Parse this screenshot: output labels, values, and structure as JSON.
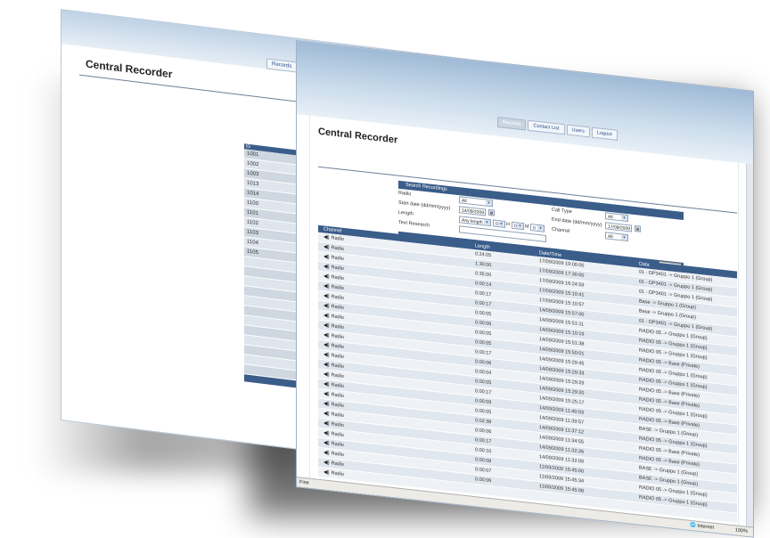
{
  "nav_tabs": [
    "Records",
    "Contact List",
    "Users",
    "Logout"
  ],
  "app_title": "Central Recorder",
  "back_table": {
    "rows": [
      "1001",
      "1002",
      "1003",
      "1013",
      "1014",
      "1100",
      "1101",
      "1102",
      "1103",
      "1104",
      "1105"
    ]
  },
  "search": {
    "heading": "Search Recordings",
    "radio_label": "Radio",
    "radio_value": "All",
    "start_date_label": "Start date (dd/mm/yyyy)",
    "start_date_value": "14/09/2009",
    "length_label": "Length",
    "length_value": "Any length",
    "length_h": "0",
    "length_m": "0",
    "length_s": "0",
    "h_unit": "H",
    "m_unit": "M",
    "text_research_label": "Text Research",
    "text_research_value": "",
    "call_type_label": "Call Type",
    "call_type_value": "All",
    "end_date_label": "End date (dd/mm/yyyy)",
    "end_date_value": "17/09/2009",
    "channel_label": "Channel",
    "channel_value": "All",
    "search_button": "Search"
  },
  "records": {
    "headers": [
      "Channel",
      "Length",
      "Date/Time",
      "Data"
    ],
    "rows": [
      [
        "Radio",
        "0:24:05",
        "17/09/2009 19:00:00",
        "01 - DP3401 -> Gruppo 1 (Group)"
      ],
      [
        "Radio",
        "1:30:00",
        "17/09/2009 17:30:00",
        "01 - DP3401 -> Gruppo 1 (Group)"
      ],
      [
        "Radio",
        "0:35:00",
        "17/09/2009 16:24:59",
        "01 - DP3401 -> Gruppo 1 (Group)"
      ],
      [
        "Radio",
        "0:00:14",
        "17/09/2009 15:10:41",
        "Base -> Gruppo 1 (Group)"
      ],
      [
        "Radio",
        "0:00:17",
        "17/09/2009 15:10:57",
        "Base -> Gruppo 1 (Group)"
      ],
      [
        "Radio",
        "0:00:17",
        "14/09/2009 15:57:00",
        "01 - DP3401 -> Gruppo 1 (Group)"
      ],
      [
        "Radio",
        "0:00:05",
        "14/09/2009 15:51:11",
        "RADIO 05 -> Gruppo 1 (Group)"
      ],
      [
        "Radio",
        "0:00:06",
        "14/09/2009 15:10:19",
        "RADIO 05 -> Gruppo 1 (Group)"
      ],
      [
        "Radio",
        "0:00:05",
        "14/09/2009 15:51:38",
        "RADIO 05 -> Gruppo 1 (Group)"
      ],
      [
        "Radio",
        "0:00:05",
        "14/09/2009 15:50:01",
        "RADIO 05 -> Base (Private)"
      ],
      [
        "Radio",
        "0:00:17",
        "14/09/2009 15:29:45",
        "RADIO 05 -> Gruppo 1 (Group)"
      ],
      [
        "Radio",
        "0:00:06",
        "14/09/2009 15:29:33",
        "RADIO 05 -> Gruppo 1 (Group)"
      ],
      [
        "Radio",
        "0:00:04",
        "14/09/2009 15:29:29",
        "RADIO 05 -> Base (Private)"
      ],
      [
        "Radio",
        "0:00:05",
        "14/09/2009 15:29:20",
        "RADIO 05 -> Base (Private)"
      ],
      [
        "Radio",
        "0:00:17",
        "14/09/2009 15:25:17",
        "RADIO 05 -> Gruppo 1 (Group)"
      ],
      [
        "Radio",
        "0:00:09",
        "14/09/2009 11:40:03",
        "RADIO 05 -> Base (Private)"
      ],
      [
        "Radio",
        "0:00:05",
        "14/09/2009 11:39:57",
        "BASE -> Gruppo 1 (Group)"
      ],
      [
        "Radio",
        "0:02:38",
        "14/09/2009 11:37:12",
        "RADIO 05 -> Gruppo 1 (Group)"
      ],
      [
        "Radio",
        "0:00:06",
        "14/09/2009 11:34:55",
        "RADIO 05 -> Base (Private)"
      ],
      [
        "Radio",
        "0:00:17",
        "14/09/2009 11:32:26",
        "RADIO 05 -> Base (Private)"
      ],
      [
        "Radio",
        "0:00:10",
        "14/09/2009 11:32:09",
        "BASE -> Gruppo 1 (Group)"
      ],
      [
        "Radio",
        "0:00:08",
        "11/09/2009 15:45:00",
        "BASE -> Gruppo 1 (Group)"
      ],
      [
        "Radio",
        "0:00:07",
        "11/09/2009 15:45:34",
        "RADIO 05 -> Gruppo 1 (Group)"
      ],
      [
        "Radio",
        "0:00:06",
        "11/09/2009 15:45:08",
        "RADIO 05 -> Gruppo 1 (Group)"
      ],
      [
        "Radio",
        "",
        "",
        ""
      ]
    ]
  },
  "status_bar": {
    "left": "Fine",
    "zone": "Internet",
    "zoom": "100%"
  }
}
